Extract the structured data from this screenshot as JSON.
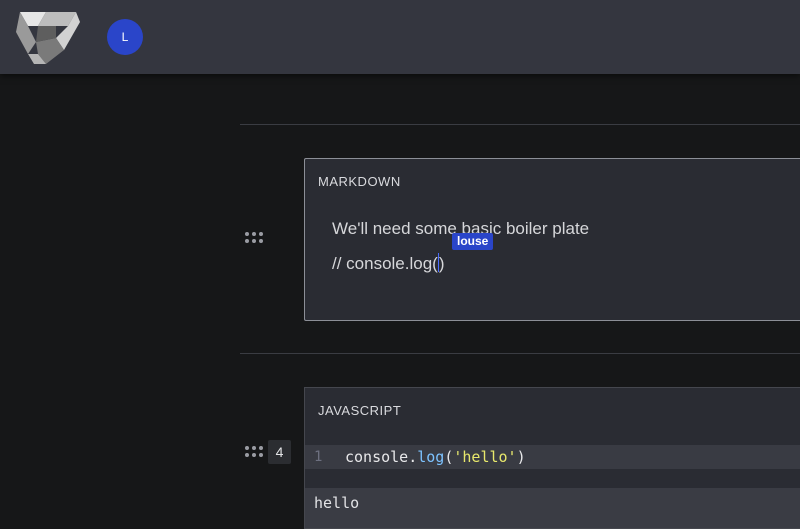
{
  "header": {
    "logo": "app-logo",
    "avatar_initial": "L"
  },
  "cells": {
    "markdown": {
      "label": "MARKDOWN",
      "line1": "We'll need some basic boiler plate",
      "line2_before_cursor": "// console.log(",
      "line2_after_cursor": ")",
      "collaborator_tag": "louse"
    },
    "javascript": {
      "label": "JAVASCRIPT",
      "exec_count": "4",
      "line_number": "1",
      "code_obj": "console",
      "code_dot": ".",
      "code_fn": "log",
      "code_open": "(",
      "code_str": "'hello'",
      "code_close": ")",
      "output": "hello"
    }
  },
  "colors": {
    "accent": "#2a45c9",
    "header_bg": "#34363f",
    "page_bg": "#161718",
    "cell_bg": "#2a2c33",
    "string": "#e8e86c",
    "function": "#7dc3ff"
  }
}
